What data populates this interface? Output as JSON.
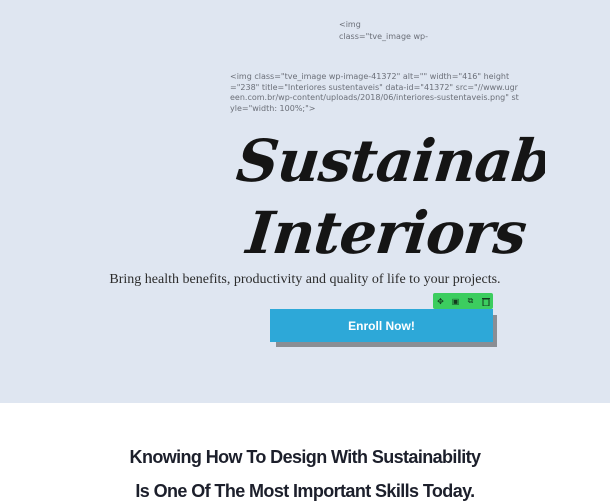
{
  "hero": {
    "code_snippet_1": "<img\nclass=\"tve_image wp-",
    "code_snippet_2": "<img class=\"tve_image wp-image-41372\" alt=\"\" width=\"416\" height=\"238\" title=\"Interiores sustentaveis\" data-id=\"41372\" src=\"//www.ugreen.com.br/wp-content/uploads/2018/06/interiores-sustentaveis.png\" style=\"width: 100%;\">",
    "heading_line1": "Sustainable",
    "heading_line2": "Interiors",
    "subtitle": "Bring health benefits, productivity and quality of life to your projects.",
    "cta_label": "Enroll Now!",
    "colors": {
      "background": "#dfe6f1",
      "cta": "#2da8d8",
      "cta_shadow": "#8a8e94",
      "toolbar": "#3ccd5f"
    }
  },
  "toolbar": {
    "icons": [
      "move-icon",
      "save-icon",
      "duplicate-icon",
      "delete-icon"
    ],
    "glyphs": [
      "✥",
      "▣",
      "⧉",
      "🗑"
    ]
  },
  "section2": {
    "heading_line1": "Knowing How To Design With  Sustainability",
    "heading_line2": "Is One Of The Most Important Skills Today."
  }
}
